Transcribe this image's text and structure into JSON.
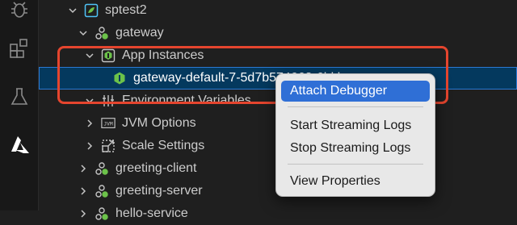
{
  "activity_bar": {
    "icons": [
      "bug-icon",
      "extensions-icon",
      "testing-flask-icon",
      "azure-icon"
    ],
    "accent_color": "#1e88e5"
  },
  "tree": {
    "items": [
      {
        "label": "sptest2",
        "icon": "spring-app-icon",
        "expanded": true
      },
      {
        "label": "gateway",
        "icon": "app-icon",
        "expanded": true
      },
      {
        "label": "App Instances",
        "icon": "instances-icon",
        "expanded": true
      },
      {
        "label": "gateway-default-7-5d7b574668-6hkhs",
        "icon": "instance-icon",
        "selected": true
      },
      {
        "label": "Environment Variables",
        "icon": "env-vars-icon",
        "expanded": true
      },
      {
        "label": "JVM Options",
        "icon": "jvm-icon",
        "expanded": false
      },
      {
        "label": "Scale Settings",
        "icon": "scale-icon",
        "expanded": false
      },
      {
        "label": "greeting-client",
        "icon": "app-icon",
        "expanded": false
      },
      {
        "label": "greeting-server",
        "icon": "app-icon",
        "expanded": false
      },
      {
        "label": "hello-service",
        "icon": "app-icon",
        "expanded": false
      }
    ]
  },
  "context_menu": {
    "items": [
      {
        "label": "Attach Debugger",
        "active": true
      },
      {
        "label": "Start Streaming Logs"
      },
      {
        "label": "Stop Streaming Logs"
      },
      {
        "label": "View Properties"
      }
    ]
  },
  "colors": {
    "highlight_border": "#e5452e",
    "menu_active": "#2f6fd6",
    "selection_bg": "#04395e"
  }
}
